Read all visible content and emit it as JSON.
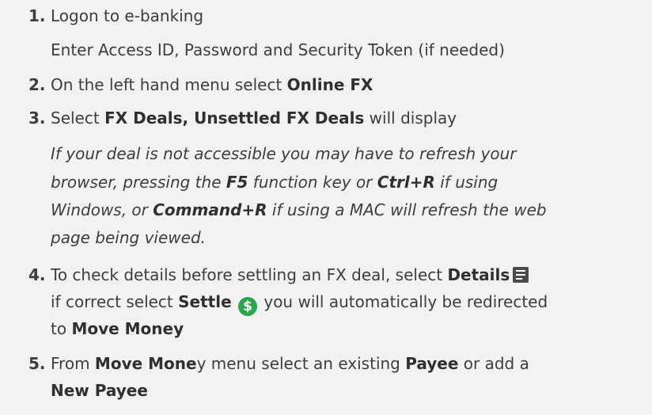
{
  "steps": [
    {
      "num": "1.",
      "line1": "Logon to e-banking",
      "line2": "Enter Access ID, Password and Security Token (if needed)"
    },
    {
      "num": "2.",
      "pre": "On the left hand menu select ",
      "bold": "Online FX"
    },
    {
      "num": "3.",
      "pre": "Select ",
      "bold": "FX Deals, Unsettled FX Deals",
      "post": " will display",
      "note": {
        "l1": "If your deal is not accessible you may have to refresh your",
        "l2a": "browser, pressing the ",
        "f5": "F5",
        "l2b": " function key or ",
        "ctrlr": "Ctrl+R",
        "l2c": " if using",
        "l3a": "Windows, or ",
        "cmdr": "Command+R",
        "l3b": " if using a MAC will refresh the web",
        "l4": "page being viewed."
      }
    },
    {
      "num": "4.",
      "a": "To check details before settling an FX deal, select ",
      "details": "Details",
      "b": "if correct select ",
      "settle": "Settle",
      "c": " you will automatically be redirected",
      "d": "to ",
      "move": "Move Money"
    },
    {
      "num": "5.",
      "a": "From ",
      "mm1": "Move Mone",
      "mm2": "y menu select an existing ",
      "payee": "Payee",
      "b": " or add a",
      "newpayee": "New Payee"
    }
  ],
  "icons": {
    "details": "document-list-icon",
    "settle": "dollar-circle-icon",
    "settle_color": "#2aa64c",
    "text_color": "#3d3d3d"
  }
}
